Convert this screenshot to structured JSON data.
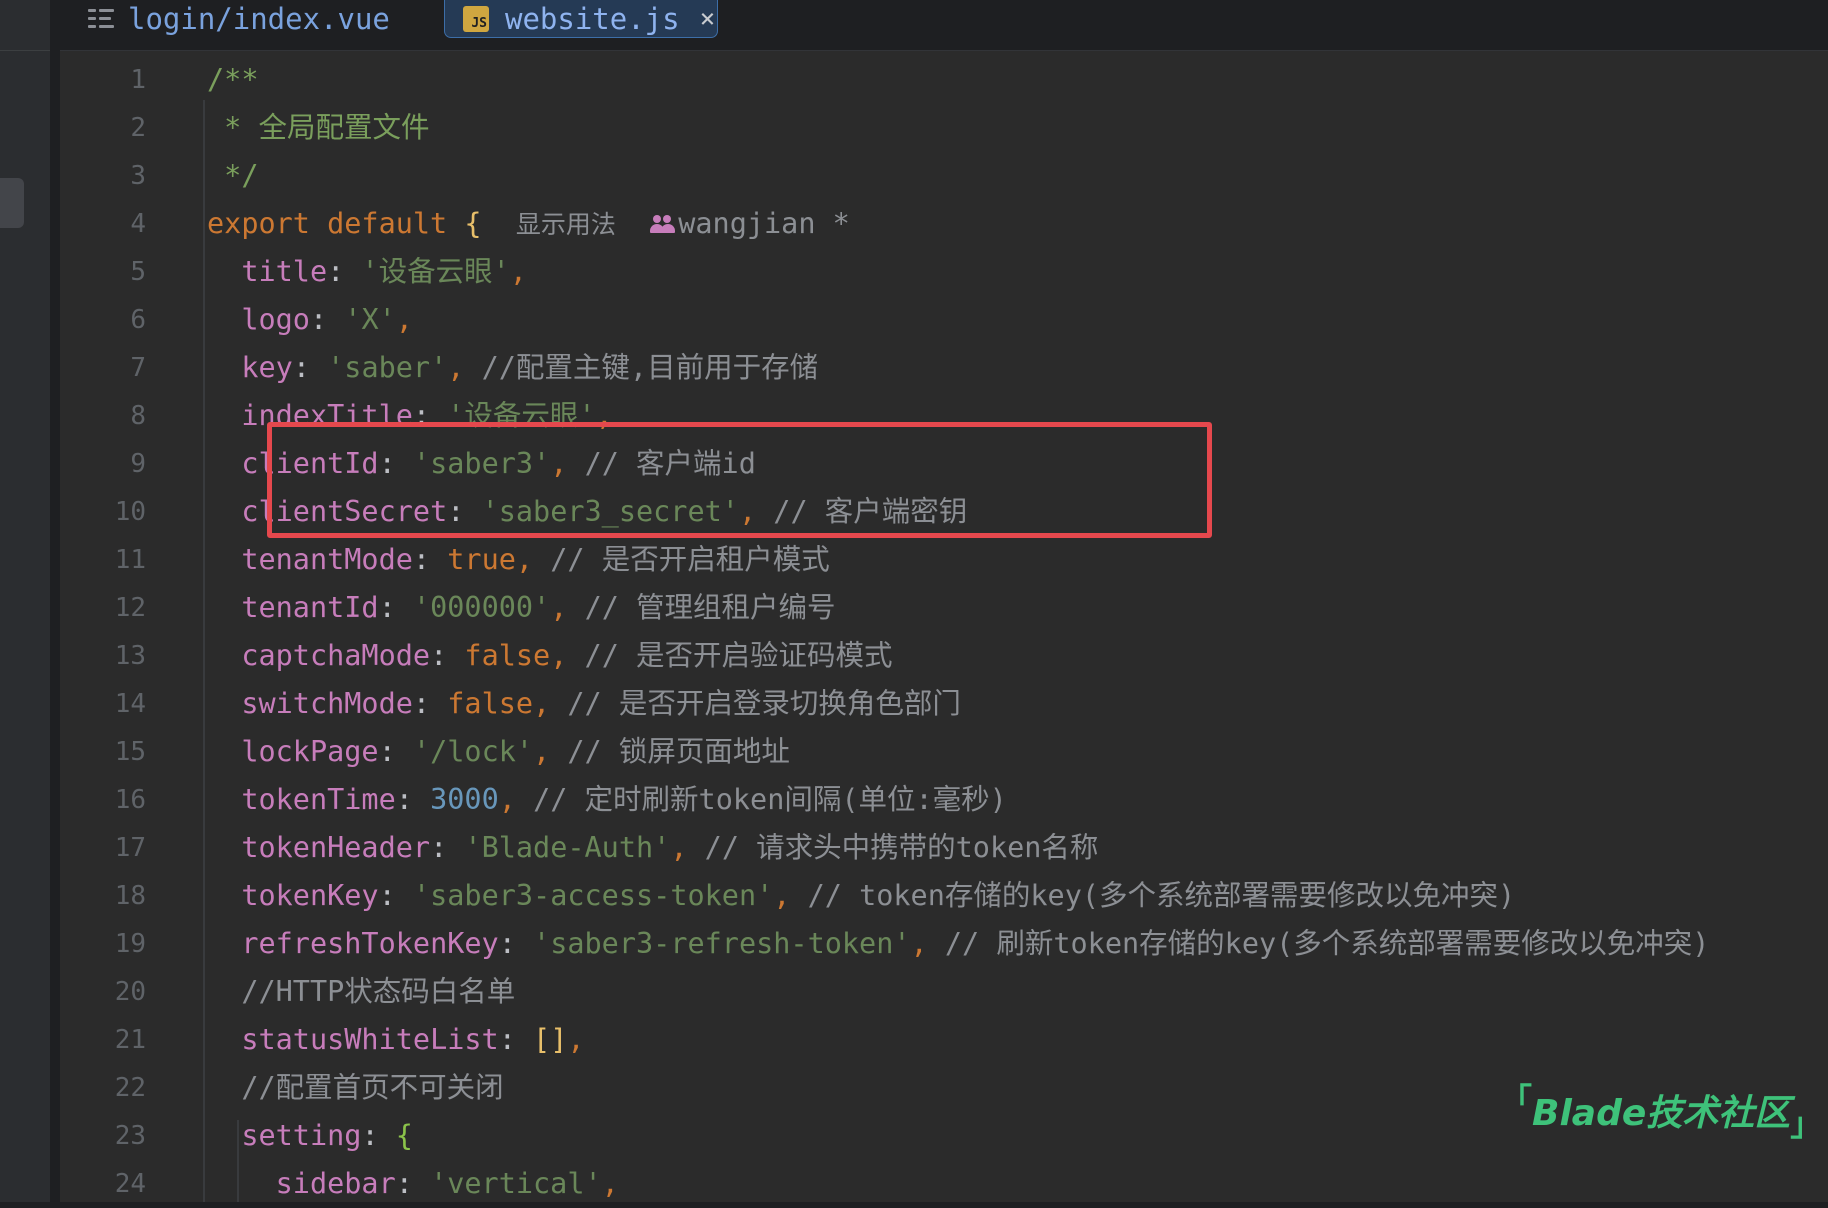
{
  "tabs": [
    {
      "label": "login/index.vue",
      "active": false,
      "icon": "list-icon"
    },
    {
      "label": "website.js",
      "active": true,
      "icon": "js-file-icon",
      "close": "×"
    }
  ],
  "js_icon_text": "JS",
  "inlay_hint": {
    "usage": "显示用法",
    "author": "wangjian *"
  },
  "line_numbers": [
    "1",
    "2",
    "3",
    "4",
    "5",
    "6",
    "7",
    "8",
    "9",
    "10",
    "11",
    "12",
    "13",
    "14",
    "15",
    "16",
    "17",
    "18",
    "19",
    "20",
    "21",
    "22",
    "23",
    "24"
  ],
  "code": {
    "l1": "/**",
    "l2": " * 全局配置文件",
    "l3": " */",
    "l4_kw": "export default",
    "l4_brace": "{",
    "l5": {
      "key": "title",
      "val": "'设备云眼'"
    },
    "l6": {
      "key": "logo",
      "val": "'X'"
    },
    "l7": {
      "key": "key",
      "val": "'saber'",
      "comment": "//配置主键,目前用于存储"
    },
    "l8": {
      "key": "indexTitle",
      "val": "'设备云眼'"
    },
    "l9": {
      "key": "clientId",
      "val": "'saber3'",
      "comment": "// 客户端id"
    },
    "l10": {
      "key": "clientSecret",
      "val": "'saber3_secret'",
      "comment": "// 客户端密钥"
    },
    "l11": {
      "key": "tenantMode",
      "val": "true",
      "comment": "// 是否开启租户模式"
    },
    "l12": {
      "key": "tenantId",
      "val": "'000000'",
      "comment": "// 管理组租户编号"
    },
    "l13": {
      "key": "captchaMode",
      "val": "false",
      "comment": "// 是否开启验证码模式"
    },
    "l14": {
      "key": "switchMode",
      "val": "false",
      "comment": "// 是否开启登录切换角色部门"
    },
    "l15": {
      "key": "lockPage",
      "val": "'/lock'",
      "comment": "// 锁屏页面地址"
    },
    "l16": {
      "key": "tokenTime",
      "val": "3000",
      "comment": "// 定时刷新token间隔(单位:毫秒)"
    },
    "l17": {
      "key": "tokenHeader",
      "val": "'Blade-Auth'",
      "comment": "// 请求头中携带的token名称"
    },
    "l18": {
      "key": "tokenKey",
      "val": "'saber3-access-token'",
      "comment": "// token存储的key(多个系统部署需要修改以免冲突)"
    },
    "l19": {
      "key": "refreshTokenKey",
      "val": "'saber3-refresh-token'",
      "comment": "// 刷新token存储的key(多个系统部署需要修改以免冲突)"
    },
    "l20": "//HTTP状态码白名单",
    "l21": {
      "key": "statusWhiteList",
      "val": "[]"
    },
    "l22": "//配置首页不可关闭",
    "l23": {
      "key": "setting",
      "val": "{"
    },
    "l24": {
      "key": "sidebar",
      "val": "'vertical'"
    }
  },
  "watermark": {
    "open": "「",
    "text": "Blade技术社区",
    "close": "」"
  },
  "colors": {
    "highlight_box": "#e5484d",
    "watermark": "#3ec27a"
  }
}
